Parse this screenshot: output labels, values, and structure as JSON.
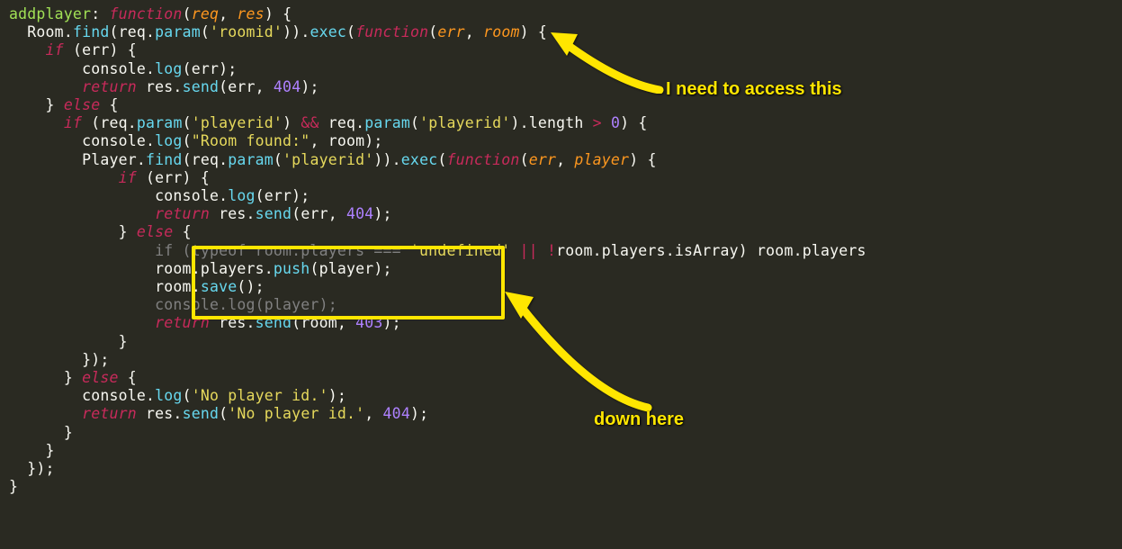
{
  "colors": {
    "bg": "#2a2a22",
    "accent": "#ffe600",
    "keyword": "#c82a5b",
    "method": "#67d8ef",
    "param": "#fd971f",
    "string": "#e6d95c",
    "number": "#ae81ff",
    "ident": "#a1e055"
  },
  "code": {
    "l1": {
      "prop": "addplayer",
      "kw": "function",
      "p1": "req",
      "p2": "res"
    },
    "l2": {
      "class": "Room",
      "m1": "find",
      "s1": "'roomid'",
      "m2": "exec",
      "kw": "function",
      "p1": "err",
      "p2": "room"
    },
    "l3": {
      "kw": "if"
    },
    "l4": {
      "m": "log"
    },
    "l5": {
      "kw": "return",
      "m": "send",
      "n": "404"
    },
    "l6": {
      "kw": "else"
    },
    "l7": {
      "kw": "if",
      "s": "'playerid'",
      "op": "&&",
      "n": "0"
    },
    "l8": {
      "m": "log",
      "s": "\"Room found:\""
    },
    "l9": {
      "class": "Player",
      "m1": "find",
      "s": "'playerid'",
      "m2": "exec",
      "kw": "function",
      "p1": "err",
      "p2": "player"
    },
    "l10": {
      "kw": "if"
    },
    "l11": {
      "m": "log"
    },
    "l12": {
      "kw": "return",
      "m": "send",
      "n": "404"
    },
    "l13": {
      "kw": "else"
    },
    "l14": {
      "kw": "if",
      "kw2": "typeof",
      "op": "===",
      "s": "'undefined'",
      "op2": "||",
      "op3": "!"
    },
    "l15": {
      "m": "push"
    },
    "l16": {
      "m": "save"
    },
    "l17": {
      "m": "log"
    },
    "l18": {
      "kw": "return",
      "m": "send",
      "n": "403"
    },
    "l21": {
      "kw": "else"
    },
    "l22": {
      "m": "log",
      "s": "'No player id.'"
    },
    "l23": {
      "kw": "return",
      "m": "send",
      "s": "'No player id.'",
      "n": "404"
    }
  },
  "annot": {
    "top": "I need to access this",
    "bottom": "down here"
  }
}
